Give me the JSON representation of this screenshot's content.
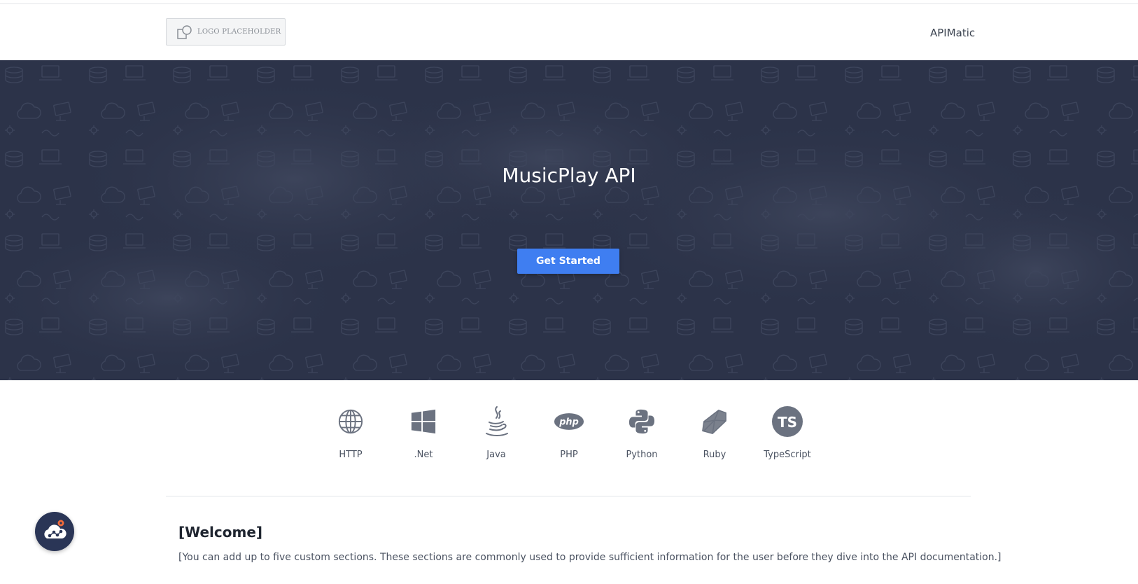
{
  "header": {
    "logo_text": "LOGO PLACEHOLDER",
    "brand_link": "APIMatic"
  },
  "hero": {
    "title": "MusicPlay API",
    "cta_label": "Get Started"
  },
  "languages": [
    {
      "label": "HTTP",
      "icon": "globe-icon"
    },
    {
      "label": ".Net",
      "icon": "windows-icon"
    },
    {
      "label": "Java",
      "icon": "java-icon"
    },
    {
      "label": "PHP",
      "icon": "php-icon"
    },
    {
      "label": "Python",
      "icon": "python-icon"
    },
    {
      "label": "Ruby",
      "icon": "ruby-icon"
    },
    {
      "label": "TypeScript",
      "icon": "typescript-icon"
    }
  ],
  "welcome": {
    "title": "[Welcome]",
    "text": "[You can add up to five custom sections. These sections are commonly used to provide sufficient information for the user before they dive into the API documentation.]"
  },
  "colors": {
    "hero_bg": "#2c3349",
    "cta_bg": "#3f7ef1",
    "icon_gray": "#6b7280",
    "fab_bg": "#2a3556",
    "fab_accent": "#f26b3a"
  }
}
